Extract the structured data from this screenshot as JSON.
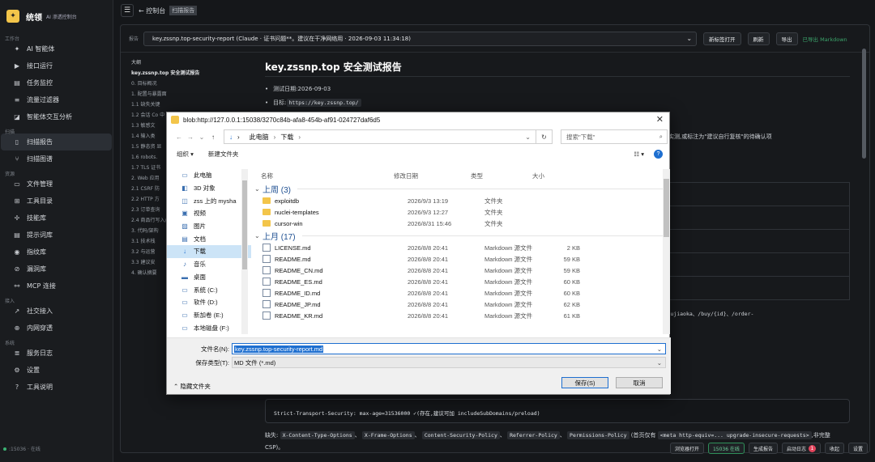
{
  "app": {
    "name": "统领",
    "subtitle": "AI 渗透控制台"
  },
  "sidebar": {
    "sections": [
      {
        "title": "工作台",
        "items": [
          {
            "label": "AI 智能体",
            "icon": "sparkle-icon",
            "glyph": "✦"
          },
          {
            "label": "接口运行",
            "icon": "play-icon",
            "glyph": "▶"
          },
          {
            "label": "任务监控",
            "icon": "monitor-icon",
            "glyph": "▤"
          },
          {
            "label": "流量过滤器",
            "icon": "filter-icon",
            "glyph": "≡"
          },
          {
            "label": "智能体交互分析",
            "icon": "chart-icon",
            "glyph": "◪"
          }
        ]
      },
      {
        "title": "扫描",
        "items": [
          {
            "label": "扫描报告",
            "icon": "document-icon",
            "glyph": "▯",
            "active": true
          },
          {
            "label": "扫描图谱",
            "icon": "graph-icon",
            "glyph": "⑂"
          }
        ]
      },
      {
        "title": "资源",
        "items": [
          {
            "label": "文件管理",
            "icon": "folder-icon",
            "glyph": "▭"
          },
          {
            "label": "工具目录",
            "icon": "tool-icon",
            "glyph": "⊞"
          },
          {
            "label": "技能库",
            "icon": "puzzle-icon",
            "glyph": "✢"
          },
          {
            "label": "提示词库",
            "icon": "book-icon",
            "glyph": "▤"
          },
          {
            "label": "指纹库",
            "icon": "fingerprint-icon",
            "glyph": "◉"
          },
          {
            "label": "漏洞库",
            "icon": "bug-icon",
            "glyph": "⊘"
          },
          {
            "label": "MCP 连接",
            "icon": "plug-icon",
            "glyph": "⚯"
          }
        ]
      },
      {
        "title": "接入",
        "items": [
          {
            "label": "社交接入",
            "icon": "share-icon",
            "glyph": "↗"
          },
          {
            "label": "内网穿透",
            "icon": "tunnel-icon",
            "glyph": "⊕"
          }
        ]
      },
      {
        "title": "系统",
        "items": [
          {
            "label": "服务日志",
            "icon": "log-icon",
            "glyph": "≣"
          },
          {
            "label": "设置",
            "icon": "gear-icon",
            "glyph": "⚙"
          },
          {
            "label": "工具说明",
            "icon": "help-icon",
            "glyph": "?"
          }
        ]
      }
    ],
    "status": ":15036 · 在线"
  },
  "topbar": {
    "back": "← 控制台",
    "tag": "扫描报告"
  },
  "report_bar": {
    "label": "报告",
    "selected": "key.zssnp.top-security-report (Claude · 证书问题**。建议在干净网络用 · 2026-09-03 11:34:18)",
    "buttons": [
      "新标签打开",
      "刷新",
      "导出"
    ],
    "exported": "已导出 Markdown"
  },
  "outline": {
    "title": "大纲",
    "items": [
      "key.zssnp.top 安全测试报告",
      "0. 目标概况",
      "1. 配置与暴露面",
      "1.1 缺失关键",
      "1.2 会话 Co 中",
      "1.3 敏感文",
      "1.4 输入类",
      "1.5 静态资 显",
      "1.6 robots.",
      "1.7 TLS 证书",
      "2. Web 应用",
      "2.1 CSRF 防",
      "2.2 HTTP 方",
      "2.3 订单查询",
      "2.4 商品行写入/篡改",
      "3. 代码/架构",
      "3.1 技术栈",
      "3.2 与运营",
      "3.3 建议安",
      "4. 确认摘要"
    ]
  },
  "doc": {
    "title": "key.zssnp.top 安全测试报告",
    "date_line": "测试日期:2026-09-03",
    "target_label": "目标:",
    "target_url": "https://key.zssnp.top/",
    "frag_right": "实测,或标注为\"建议自行复核\"的待确认项",
    "frag_code": "simon/dujiaoka、/buy/{id}、/order-",
    "code_line": "Strict-Transport-Security: max-age=31536000   ✓(存在,建议可加 includeSubDomains/preload)",
    "missing_prefix": "缺失:",
    "missing_items": [
      "X-Content-Type-Options",
      "X-Frame-Options",
      "Content-Security-Policy",
      "Referrer-Policy",
      "Permissions-Policy"
    ],
    "missing_note1": "(首页仅有",
    "missing_code": "<meta http-equiv=... upgrade-insecure-requests>",
    "missing_note2": ",非完整 CSP)。"
  },
  "bottombar": {
    "browser": "浏览器打开",
    "status_badge": "15036 在线",
    "gen": "生成报告",
    "log": "启动日志",
    "log_count": "1",
    "minimize": "收起",
    "settings": "设置"
  },
  "dialog": {
    "title": "blob:http://127.0.0.1:15038/3270c84b-afa8-454b-af91-024727daf6d5",
    "path": [
      "此电脑",
      "下载"
    ],
    "search_placeholder": "搜索\"下载\"",
    "organize": "组织 ▾",
    "new_folder": "新建文件夹",
    "tree": [
      {
        "label": "此电脑",
        "icon": "computer-icon",
        "glyph": "▭"
      },
      {
        "label": "3D 对象",
        "icon": "cube-icon",
        "glyph": "◧"
      },
      {
        "label": "zss 上的 mysha",
        "icon": "network-drive-icon",
        "glyph": "◫"
      },
      {
        "label": "视频",
        "icon": "video-icon",
        "glyph": "▣"
      },
      {
        "label": "图片",
        "icon": "picture-icon",
        "glyph": "▨"
      },
      {
        "label": "文档",
        "icon": "documents-icon",
        "glyph": "▤"
      },
      {
        "label": "下载",
        "icon": "download-icon",
        "glyph": "↓",
        "selected": true
      },
      {
        "label": "音乐",
        "icon": "music-icon",
        "glyph": "♪"
      },
      {
        "label": "桌面",
        "icon": "desktop-icon",
        "glyph": "▬"
      },
      {
        "label": "系统 (C:)",
        "icon": "drive-icon",
        "glyph": "▭"
      },
      {
        "label": "软件 (D:)",
        "icon": "drive-icon",
        "glyph": "▭"
      },
      {
        "label": "新加卷 (E:)",
        "icon": "drive-icon",
        "glyph": "▭"
      },
      {
        "label": "本地磁盘 (F:)",
        "icon": "drive-icon",
        "glyph": "▭"
      }
    ],
    "columns": {
      "name": "名称",
      "date": "修改日期",
      "type": "类型",
      "size": "大小"
    },
    "groups": [
      {
        "title": "上周 (3)",
        "files": [
          {
            "name": "exploitdb",
            "date": "2026/9/3 13:19",
            "type": "文件夹",
            "size": "",
            "kind": "folder"
          },
          {
            "name": "nuclei-templates",
            "date": "2026/9/3 12:27",
            "type": "文件夹",
            "size": "",
            "kind": "folder"
          },
          {
            "name": "cursor-win",
            "date": "2026/8/31 15:46",
            "type": "文件夹",
            "size": "",
            "kind": "folder"
          }
        ]
      },
      {
        "title": "上月 (17)",
        "files": [
          {
            "name": "LICENSE.md",
            "date": "2026/8/8 20:41",
            "type": "Markdown 源文件",
            "size": "2 KB",
            "kind": "md"
          },
          {
            "name": "README.md",
            "date": "2026/8/8 20:41",
            "type": "Markdown 源文件",
            "size": "59 KB",
            "kind": "md"
          },
          {
            "name": "README_CN.md",
            "date": "2026/8/8 20:41",
            "type": "Markdown 源文件",
            "size": "59 KB",
            "kind": "md"
          },
          {
            "name": "README_ES.md",
            "date": "2026/8/8 20:41",
            "type": "Markdown 源文件",
            "size": "60 KB",
            "kind": "md"
          },
          {
            "name": "README_ID.md",
            "date": "2026/8/8 20:41",
            "type": "Markdown 源文件",
            "size": "60 KB",
            "kind": "md"
          },
          {
            "name": "README_JP.md",
            "date": "2026/8/8 20:41",
            "type": "Markdown 源文件",
            "size": "62 KB",
            "kind": "md"
          },
          {
            "name": "README_KR.md",
            "date": "2026/8/8 20:41",
            "type": "Markdown 源文件",
            "size": "61 KB",
            "kind": "md"
          }
        ]
      }
    ],
    "filename_label": "文件名(N):",
    "filename_value": "key.zssnp.top-security-report.md",
    "filetype_label": "保存类型(T):",
    "filetype_value": "MD 文件 (*.md)",
    "hide_folders": "隐藏文件夹",
    "save": "保存(S)",
    "cancel": "取消"
  }
}
